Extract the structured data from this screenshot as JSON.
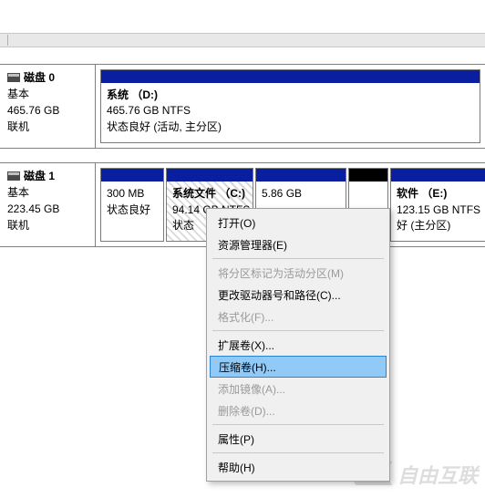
{
  "disks": [
    {
      "name": "磁盘 0",
      "type": "基本",
      "size": "465.76 GB",
      "status": "联机",
      "volumes": [
        {
          "title": "系统 （D:)",
          "size_fs": "465.76 GB NTFS",
          "status": "状态良好 (活动, 主分区)"
        }
      ]
    },
    {
      "name": "磁盘 1",
      "type": "基本",
      "size": "223.45 GB",
      "status": "联机",
      "volumes": [
        {
          "title": "",
          "size_fs": "300 MB",
          "status": "状态良好"
        },
        {
          "title": "系统文件 （C:)",
          "size_fs": "94.14 GB NTFS",
          "status": "状态"
        },
        {
          "title": "",
          "size_fs": "5.86 GB",
          "status": ""
        },
        {
          "title": "",
          "size_fs": "",
          "status": ""
        },
        {
          "title": "软件 （E:)",
          "size_fs": "123.15 GB NTFS",
          "status": "好 (主分区)"
        }
      ]
    }
  ],
  "context_menu": {
    "open": "打开(O)",
    "explorer": "资源管理器(E)",
    "mark_active": "将分区标记为活动分区(M)",
    "change_letter": "更改驱动器号和路径(C)...",
    "format": "格式化(F)...",
    "extend": "扩展卷(X)...",
    "shrink": "压缩卷(H)...",
    "mirror": "添加镜像(A)...",
    "delete": "删除卷(D)...",
    "properties": "属性(P)",
    "help": "帮助(H)"
  },
  "watermark": "自由互联"
}
